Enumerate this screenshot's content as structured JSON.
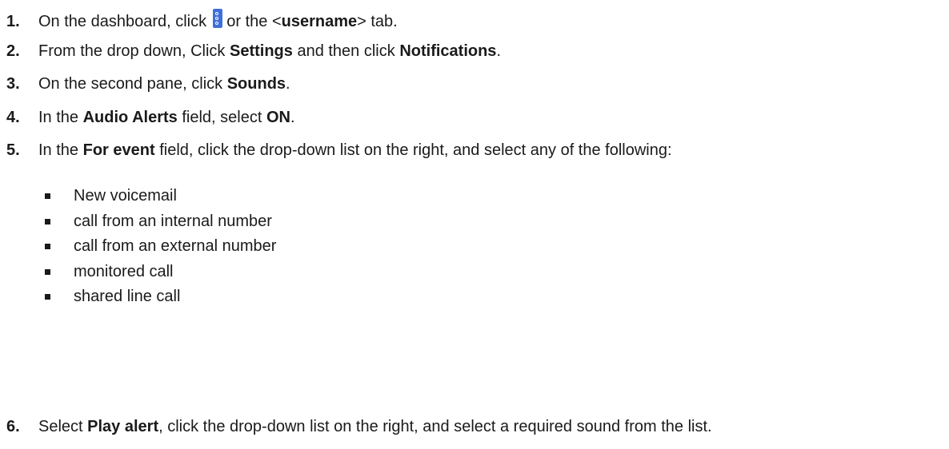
{
  "steps": [
    {
      "number": "1.",
      "parts": [
        "On the dashboard, click ",
        " or the <",
        "username",
        "> tab."
      ],
      "icon": "kebab-menu-icon"
    },
    {
      "number": "2.",
      "parts": [
        "From the drop down, Click ",
        "Settings",
        " and then click ",
        "Notifications",
        "."
      ]
    },
    {
      "number": "3.",
      "parts": [
        "On the second pane, click ",
        "Sounds",
        "."
      ]
    },
    {
      "number": "4.",
      "parts": [
        "In the ",
        "Audio Alerts",
        " field, select ",
        "ON",
        "."
      ]
    },
    {
      "number": "5.",
      "parts": [
        "In the ",
        "For event",
        " field, click the drop-down list on the right, and select any of the following:"
      ],
      "sub_items": [
        "New voicemail",
        "call from an internal number",
        "call from an external number",
        "monitored call",
        "shared line call"
      ]
    },
    {
      "number": "6.",
      "parts": [
        "Select ",
        "Play alert",
        ", click the drop-down list on the right, and select a required sound from the list."
      ]
    }
  ],
  "colors": {
    "text": "#1a1a1a",
    "icon_accent": "#3f6fd8"
  }
}
